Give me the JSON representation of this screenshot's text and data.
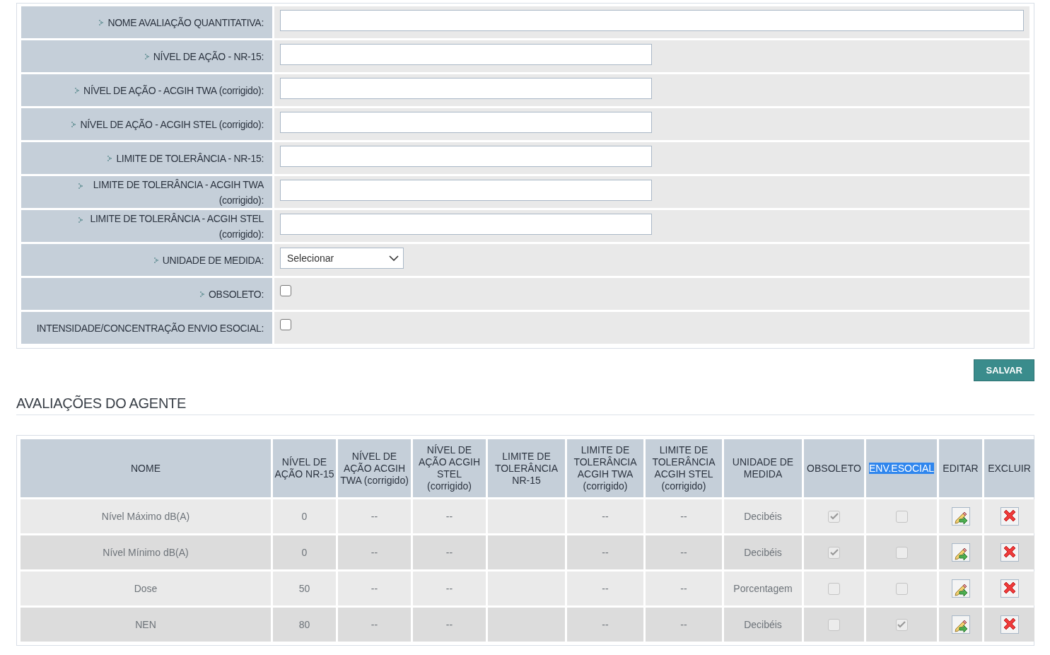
{
  "form": {
    "fields": [
      {
        "label": "NOME AVALIAÇÃO QUANTITATIVA:",
        "bullet": true,
        "kind": "text",
        "wide": true
      },
      {
        "label": "NÍVEL DE AÇÃO - NR-15:",
        "bullet": true,
        "kind": "text",
        "wide": false
      },
      {
        "label": "NÍVEL DE AÇÃO - ACGIH TWA (corrigido):",
        "bullet": true,
        "kind": "text",
        "wide": false
      },
      {
        "label": "NÍVEL DE AÇÃO - ACGIH STEL (corrigido):",
        "bullet": true,
        "kind": "text",
        "wide": false
      },
      {
        "label": "LIMITE DE TOLERÂNCIA - NR-15:",
        "bullet": true,
        "kind": "text",
        "wide": false
      },
      {
        "label": "LIMITE DE TOLERÂNCIA - ACGIH TWA (corrigido):",
        "bullet": true,
        "kind": "text",
        "wide": false
      },
      {
        "label": "LIMITE DE TOLERÂNCIA - ACGIH STEL (corrigido):",
        "bullet": true,
        "kind": "text",
        "wide": false
      },
      {
        "label": "UNIDADE DE MEDIDA:",
        "bullet": true,
        "kind": "select",
        "value": "Selecionar"
      },
      {
        "label": "OBSOLETO:",
        "bullet": true,
        "kind": "checkbox",
        "checked": false
      },
      {
        "label": "INTENSIDADE/CONCENTRAÇÃO ENVIO ESOCIAL:",
        "bullet": false,
        "kind": "checkbox",
        "checked": false
      }
    ],
    "save_button": "SALVAR"
  },
  "section_title": "AVALIAÇÕES DO AGENTE",
  "table": {
    "columns": [
      {
        "label": "NOME",
        "highlighted": false
      },
      {
        "label": "NÍVEL DE AÇÃO NR-15",
        "highlighted": false
      },
      {
        "label": "NÍVEL DE AÇÃO ACGIH TWA (corrigido)",
        "highlighted": false
      },
      {
        "label": "NÍVEL DE AÇÃO ACGIH STEL (corrigido)",
        "highlighted": false
      },
      {
        "label": "LIMITE DE TOLERÂNCIA NR-15",
        "highlighted": false
      },
      {
        "label": "LIMITE DE TOLERÂNCIA ACGIH TWA (corrigido)",
        "highlighted": false
      },
      {
        "label": "LIMITE DE TOLERÂNCIA ACGIH STEL (corrigido)",
        "highlighted": false
      },
      {
        "label": "UNIDADE DE MEDIDA",
        "highlighted": false
      },
      {
        "label": "OBSOLETO",
        "highlighted": false
      },
      {
        "label": "ENV.ESOCIAL",
        "highlighted": true
      },
      {
        "label": "EDITAR",
        "highlighted": false
      },
      {
        "label": "EXCLUIR",
        "highlighted": false
      }
    ],
    "rows": [
      {
        "name": "Nível Máximo dB(A)",
        "nivel_nr15": "0",
        "nivel_twa": "--",
        "nivel_stel": "--",
        "limite_twa": "--",
        "limite_stel": "--",
        "unit": "Decibéis",
        "obsolete": true,
        "esocial": false
      },
      {
        "name": "Nível Mínimo dB(A)",
        "nivel_nr15": "0",
        "nivel_twa": "--",
        "nivel_stel": "--",
        "limite_twa": "--",
        "limite_stel": "--",
        "unit": "Decibéis",
        "obsolete": true,
        "esocial": false
      },
      {
        "name": "Dose",
        "nivel_nr15": "50",
        "nivel_twa": "--",
        "nivel_stel": "--",
        "limite_twa": "--",
        "limite_stel": "--",
        "unit": "Porcentagem",
        "obsolete": false,
        "esocial": false
      },
      {
        "name": "NEN",
        "nivel_nr15": "80",
        "nivel_twa": "--",
        "nivel_stel": "--",
        "limite_twa": "--",
        "limite_stel": "--",
        "unit": "Decibéis",
        "obsolete": false,
        "esocial": true
      }
    ]
  }
}
